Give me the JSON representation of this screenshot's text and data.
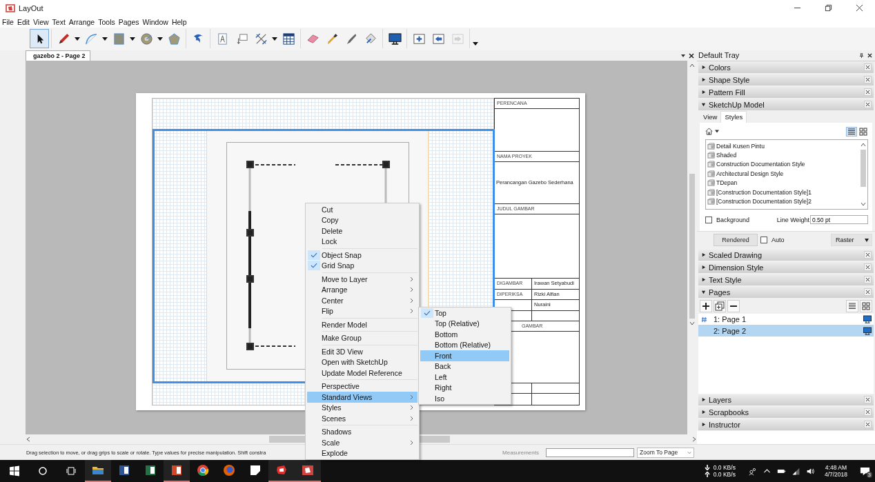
{
  "window": {
    "title": "LayOut"
  },
  "menu_bar": [
    "File",
    "Edit",
    "View",
    "Text",
    "Arrange",
    "Tools",
    "Pages",
    "Window",
    "Help"
  ],
  "tool_groups": [
    [
      {
        "kind": "select",
        "selected": true,
        "dropdown": false,
        "disabled": false
      }
    ],
    [
      {
        "kind": "pencil",
        "selected": false,
        "dropdown": true,
        "disabled": false
      },
      {
        "kind": "arc",
        "selected": false,
        "dropdown": true,
        "disabled": false
      },
      {
        "kind": "rectangle",
        "selected": false,
        "dropdown": true,
        "disabled": false
      },
      {
        "kind": "circle",
        "selected": false,
        "dropdown": true,
        "disabled": false
      },
      {
        "kind": "polygon",
        "selected": false,
        "dropdown": false,
        "disabled": false
      }
    ],
    [
      {
        "kind": "offset",
        "selected": false,
        "dropdown": false,
        "disabled": false
      }
    ],
    [
      {
        "kind": "text",
        "selected": false,
        "dropdown": false,
        "disabled": false
      },
      {
        "kind": "label",
        "selected": false,
        "dropdown": false,
        "disabled": false
      },
      {
        "kind": "dimension",
        "selected": false,
        "dropdown": true,
        "disabled": false
      },
      {
        "kind": "table",
        "selected": false,
        "dropdown": false,
        "disabled": false
      }
    ],
    [
      {
        "kind": "eraser",
        "selected": false,
        "dropdown": false,
        "disabled": false
      },
      {
        "kind": "eyedropper",
        "selected": false,
        "dropdown": false,
        "disabled": false
      },
      {
        "kind": "knife",
        "selected": false,
        "dropdown": false,
        "disabled": false
      },
      {
        "kind": "join",
        "selected": false,
        "dropdown": false,
        "disabled": false
      }
    ],
    [
      {
        "kind": "monitor",
        "selected": false,
        "dropdown": false,
        "disabled": false
      }
    ],
    [
      {
        "kind": "page_add",
        "selected": false,
        "dropdown": false,
        "disabled": false
      },
      {
        "kind": "page_prev",
        "selected": false,
        "dropdown": false,
        "disabled": false
      },
      {
        "kind": "page_next",
        "selected": false,
        "dropdown": false,
        "disabled": true
      }
    ]
  ],
  "document_tab": {
    "label": "gazebo 2 - Page 2"
  },
  "title_block": {
    "planner_label": "PERENCANA",
    "project_label": "NAMA PROYEK",
    "project_value": "Perancangan Gazebo Sederhana",
    "drawing_title_label": "JUDUL GAMBAR",
    "people": [
      {
        "label": "DIGAMBAR",
        "value": "Irawan Setyabudi"
      },
      {
        "label": "DIPERIKSA",
        "value": "Rizki Alfian"
      },
      {
        "value": "Nuraini"
      }
    ],
    "bottom_label": "GAMBAR"
  },
  "context_menu": {
    "groups": [
      [
        {
          "label": "Cut",
          "checked": false,
          "submenu": false,
          "selected": false
        },
        {
          "label": "Copy",
          "checked": false,
          "submenu": false,
          "selected": false
        },
        {
          "label": "Delete",
          "checked": false,
          "submenu": false,
          "selected": false
        },
        {
          "label": "Lock",
          "checked": false,
          "submenu": false,
          "selected": false
        }
      ],
      [
        {
          "label": "Object Snap",
          "checked": true,
          "submenu": false,
          "selected": false
        },
        {
          "label": "Grid Snap",
          "checked": true,
          "submenu": false,
          "selected": false
        }
      ],
      [
        {
          "label": "Move to Layer",
          "checked": false,
          "submenu": true,
          "selected": false
        },
        {
          "label": "Arrange",
          "checked": false,
          "submenu": true,
          "selected": false
        },
        {
          "label": "Center",
          "checked": false,
          "submenu": true,
          "selected": false
        },
        {
          "label": "Flip",
          "checked": false,
          "submenu": true,
          "selected": false
        }
      ],
      [
        {
          "label": "Render Model",
          "checked": false,
          "submenu": false,
          "selected": false
        }
      ],
      [
        {
          "label": "Make Group",
          "checked": false,
          "submenu": false,
          "selected": false
        }
      ],
      [
        {
          "label": "Edit 3D View",
          "checked": false,
          "submenu": false,
          "selected": false
        },
        {
          "label": "Open with SketchUp",
          "checked": false,
          "submenu": false,
          "selected": false
        },
        {
          "label": "Update Model Reference",
          "checked": false,
          "submenu": false,
          "selected": false
        }
      ],
      [
        {
          "label": "Perspective",
          "checked": false,
          "submenu": false,
          "selected": false
        },
        {
          "label": "Standard Views",
          "checked": false,
          "submenu": true,
          "selected": true
        },
        {
          "label": "Styles",
          "checked": false,
          "submenu": true,
          "selected": false
        },
        {
          "label": "Scenes",
          "checked": false,
          "submenu": true,
          "selected": false
        }
      ],
      [
        {
          "label": "Shadows",
          "checked": false,
          "submenu": false,
          "selected": false
        },
        {
          "label": "Scale",
          "checked": false,
          "submenu": true,
          "selected": false
        },
        {
          "label": "Explode",
          "checked": false,
          "submenu": false,
          "selected": false
        }
      ]
    ]
  },
  "submenu": {
    "items": [
      {
        "label": "Top",
        "checked": true,
        "selected": false
      },
      {
        "label": "Top (Relative)",
        "checked": false,
        "selected": false
      },
      {
        "label": "Bottom",
        "checked": false,
        "selected": false
      },
      {
        "label": "Bottom (Relative)",
        "checked": false,
        "selected": false
      },
      {
        "label": "Front",
        "checked": false,
        "selected": true
      },
      {
        "label": "Back",
        "checked": false,
        "selected": false
      },
      {
        "label": "Left",
        "checked": false,
        "selected": false
      },
      {
        "label": "Right",
        "checked": false,
        "selected": false
      },
      {
        "label": "Iso",
        "checked": false,
        "selected": false
      }
    ]
  },
  "tray": {
    "title": "Default Tray",
    "panels": [
      {
        "title": "Colors",
        "expanded": false,
        "kind": "plain"
      },
      {
        "title": "Shape Style",
        "expanded": false,
        "kind": "plain"
      },
      {
        "title": "Pattern Fill",
        "expanded": false,
        "kind": "plain"
      },
      {
        "title": "SketchUp Model",
        "expanded": true,
        "kind": "model"
      },
      {
        "title": "Scaled Drawing",
        "expanded": false,
        "kind": "plain"
      },
      {
        "title": "Dimension Style",
        "expanded": false,
        "kind": "plain"
      },
      {
        "title": "Text Style",
        "expanded": false,
        "kind": "plain"
      },
      {
        "title": "Pages",
        "expanded": true,
        "kind": "pages"
      },
      {
        "title": "Layers",
        "expanded": false,
        "kind": "plain"
      },
      {
        "title": "Scrapbooks",
        "expanded": false,
        "kind": "plain"
      },
      {
        "title": "Instructor",
        "expanded": false,
        "kind": "plain"
      }
    ],
    "model": {
      "tabs": [
        {
          "label": "View",
          "selected": false
        },
        {
          "label": "Styles",
          "selected": true
        }
      ],
      "styles": [
        "Detail Kusen Pintu",
        "Shaded",
        "Construction Documentation Style",
        "Architectural Design Style",
        "TDepan",
        "[Construction Documentation Style]1",
        "[Construction Documentation Style]2"
      ],
      "background": {
        "label": "Background",
        "checked": false
      },
      "line_weight": {
        "label": "Line Weight",
        "value": "0.50 pt"
      },
      "render_button": "Rendered",
      "auto": {
        "label": "Auto",
        "checked": false
      },
      "render_mode": "Raster"
    },
    "pages": [
      {
        "label": "1: Page 1",
        "selected": false,
        "numbered": true
      },
      {
        "label": "2: Page 2",
        "selected": true,
        "numbered": false
      }
    ]
  },
  "status_bar": {
    "hint": "Drag selection to move, or drag grips to scale or rotate. Type values for precise manipulation. Shift constra",
    "measurements_label": "Measurements",
    "zoom": "Zoom To Page"
  },
  "taskbar": {
    "apps": [
      {
        "kind": "explorer",
        "running": true
      },
      {
        "kind": "word",
        "running": false
      },
      {
        "kind": "excel",
        "running": false
      },
      {
        "kind": "powerpoint",
        "running": true
      },
      {
        "kind": "chrome",
        "running": false
      },
      {
        "kind": "firefox",
        "running": false
      },
      {
        "kind": "notes",
        "running": false
      },
      {
        "kind": "sketchup",
        "running": true
      },
      {
        "kind": "layout",
        "running": true
      }
    ],
    "download": "0.0 KB/s",
    "upload": "0.0 KB/s",
    "time": "4:48 AM",
    "date": "4/7/2018",
    "notifications": "3"
  }
}
